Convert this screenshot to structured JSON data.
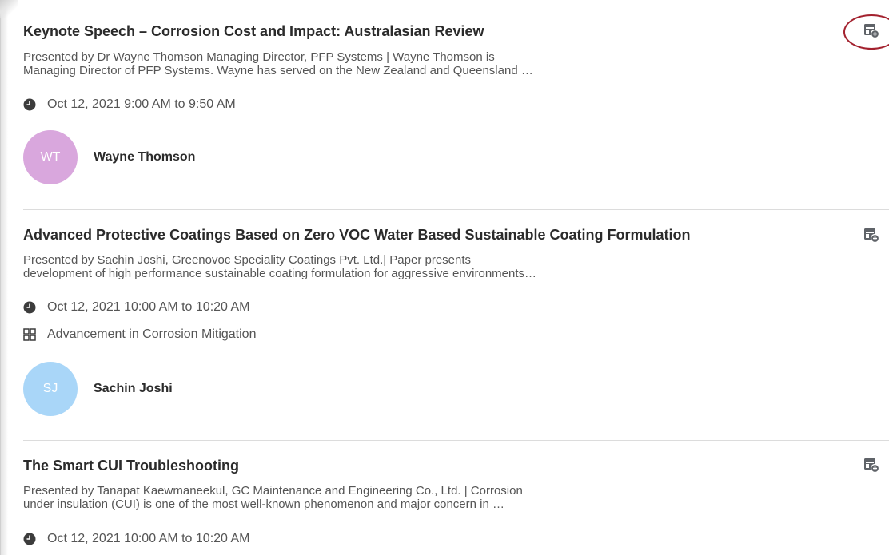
{
  "colors": {
    "title": "#2b2b2b",
    "text": "#555555",
    "divider": "#dcdcdc",
    "annotation": "#a3212e",
    "icon": "#5f6368"
  },
  "icons": {
    "time": "clock-icon",
    "track": "grid-icon",
    "add_to_calendar": "calendar-add-icon"
  },
  "sessions": [
    {
      "title": "Keynote Speech – Corrosion Cost and Impact: Australasian Review",
      "description_line1": "Presented by Dr Wayne Thomson Managing Director, PFP Systems | Wayne Thomson is",
      "description_line2": "Managing Director of PFP Systems. Wayne has served on the New Zealand and Queensland …",
      "time": "Oct 12, 2021 9:00 AM to 9:50 AM",
      "speaker": {
        "initials": "WT",
        "name": "Wayne Thomson",
        "avatar_color": "#d9a7dd"
      }
    },
    {
      "title": "Advanced Protective Coatings Based on Zero VOC Water Based Sustainable Coating Formulation",
      "description_line1": "Presented by Sachin Joshi, Greenovoc Speciality Coatings Pvt. Ltd.| Paper presents",
      "description_line2": "development of high performance sustainable coating formulation for aggressive environments…",
      "time": "Oct 12, 2021 10:00 AM to 10:20 AM",
      "track": "Advancement in Corrosion Mitigation",
      "speaker": {
        "initials": "SJ",
        "name": "Sachin Joshi",
        "avatar_color": "#a9d6f8"
      }
    },
    {
      "title": "The Smart CUI Troubleshooting",
      "description_line1": "Presented by Tanapat Kaewmaneekul, GC Maintenance and Engineering Co., Ltd. | Corrosion",
      "description_line2": "under insulation (CUI) is one of the most well-known phenomenon and major concern in …",
      "time": "Oct 12, 2021 10:00 AM to 10:20 AM"
    }
  ]
}
